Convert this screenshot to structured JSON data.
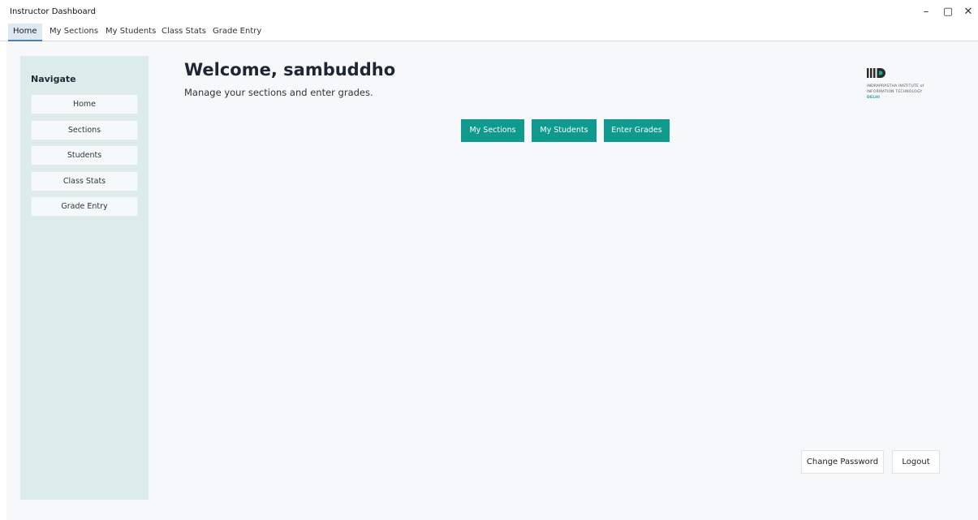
{
  "window": {
    "title": "Instructor Dashboard",
    "controls": {
      "minimize": "–",
      "maximize": "▢",
      "close": "✕"
    }
  },
  "tabs": [
    {
      "label": "Home",
      "active": true
    },
    {
      "label": "My Sections",
      "active": false
    },
    {
      "label": "My Students",
      "active": false
    },
    {
      "label": "Class Stats",
      "active": false
    },
    {
      "label": "Grade Entry",
      "active": false
    }
  ],
  "sidebar": {
    "title": "Navigate",
    "items": [
      {
        "label": "Home"
      },
      {
        "label": "Sections"
      },
      {
        "label": "Students"
      },
      {
        "label": "Class Stats"
      },
      {
        "label": "Grade Entry"
      }
    ]
  },
  "main": {
    "welcome": "Welcome, sambuddho",
    "subtitle": "Manage your sections and enter grades.",
    "actions": [
      {
        "label": "My Sections"
      },
      {
        "label": "My Students"
      },
      {
        "label": "Enter Grades"
      }
    ]
  },
  "logo": {
    "lines": [
      "INDRAPRASTHA INSTITUTE of",
      "INFORMATION TECHNOLOGY",
      "DELHI"
    ]
  },
  "footer": {
    "change_password": "Change Password",
    "logout": "Logout"
  },
  "colors": {
    "accent": "#0e9a8c",
    "sidebar_bg": "#dbeceb",
    "content_bg": "#f6f8fa",
    "active_tab": "#dfe9f4"
  }
}
